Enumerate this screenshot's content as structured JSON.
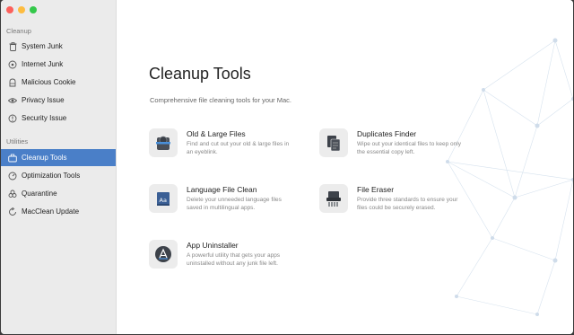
{
  "window": {
    "controls": [
      "close",
      "minimize",
      "zoom"
    ]
  },
  "sidebar": {
    "sections": [
      {
        "label": "Cleanup",
        "items": [
          {
            "label": "System Junk",
            "icon": "trash-icon"
          },
          {
            "label": "Internet Junk",
            "icon": "globe-icon"
          },
          {
            "label": "Malicious Cookie",
            "icon": "cookie-icon"
          },
          {
            "label": "Privacy Issue",
            "icon": "eye-icon"
          },
          {
            "label": "Security Issue",
            "icon": "shield-icon"
          }
        ]
      },
      {
        "label": "Utilities",
        "items": [
          {
            "label": "Cleanup Tools",
            "icon": "toolbox-icon",
            "active": true
          },
          {
            "label": "Optimization Tools",
            "icon": "speed-icon"
          },
          {
            "label": "Quarantine",
            "icon": "biohazard-icon"
          },
          {
            "label": "MacClean Update",
            "icon": "refresh-icon"
          }
        ]
      }
    ],
    "active_color": "#4a7fc8"
  },
  "main": {
    "title": "Cleanup Tools",
    "subtitle": "Comprehensive file cleaning tools for your Mac.",
    "tools": [
      {
        "name": "Old & Large Files",
        "desc": "Find and cut out your old & large files in an eyeblink.",
        "icon": "files-cutter-icon"
      },
      {
        "name": "Duplicates Finder",
        "desc": "Wipe out your identical files to keep only the essential copy left.",
        "icon": "duplicate-files-icon"
      },
      {
        "name": "Language File Clean",
        "desc": "Delete your unneeded language files saved in multilingual apps.",
        "icon": "language-file-icon"
      },
      {
        "name": "File Eraser",
        "desc": "Provide three standards to ensure your files could be securely erased.",
        "icon": "file-shredder-icon"
      },
      {
        "name": "App Uninstaller",
        "desc": "A powerful utility that gets your apps uninstalled without any junk file left.",
        "icon": "app-uninstall-icon"
      }
    ]
  }
}
